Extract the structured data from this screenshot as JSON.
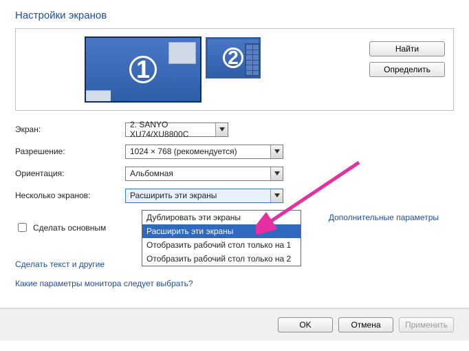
{
  "title": "Настройки экранов",
  "monitors": {
    "m1": "1",
    "m2": "2"
  },
  "buttons": {
    "find": "Найти",
    "detect": "Определить"
  },
  "form": {
    "screen_label": "Экран:",
    "resolution_label": "Разрешение:",
    "orientation_label": "Ориентация:",
    "multiple_label": "Несколько экранов:",
    "screen_value": "2. SANYO XU74/XU8800C",
    "resolution_value": "1024 × 768 (рекомендуется)",
    "orientation_value": "Альбомная",
    "multiple_value": "Расширить эти экраны"
  },
  "dropdown": {
    "options": [
      "Дублировать эти экраны",
      "Расширить эти экраны",
      "Отобразить рабочий стол только на 1",
      "Отобразить рабочий стол только на 2"
    ],
    "selected_index": 1
  },
  "make_main": "Сделать основным",
  "advanced": "Дополнительные параметры",
  "link1": "Сделать текст и другие",
  "link2": "Какие параметры монитора следует выбрать?",
  "footer": {
    "ok": "OK",
    "cancel": "Отмена",
    "apply": "Применить"
  }
}
